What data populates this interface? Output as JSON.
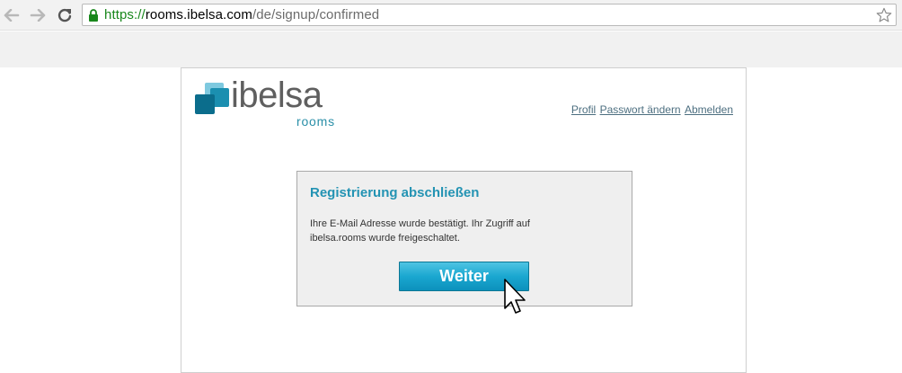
{
  "browser": {
    "url_scheme": "https://",
    "url_host": "rooms.ibelsa.com",
    "url_path": "/de/signup/confirmed",
    "icons": [
      "back-arrow-icon",
      "forward-arrow-icon",
      "reload-icon",
      "lock-icon",
      "star-icon"
    ]
  },
  "logo": {
    "word": "ibelsa",
    "sub": "rooms",
    "colors": [
      "#1b8fb0",
      "#7ec9df",
      "#0b6d8c"
    ]
  },
  "nav": {
    "links": [
      "Profil",
      "Passwort ändern",
      "Abmelden"
    ]
  },
  "card": {
    "title": "Registrierung abschließen",
    "line1": "Ihre E-Mail Adresse wurde bestätigt. Ihr Zugriff auf",
    "line2": "ibelsa.rooms wurde freigeschaltet.",
    "button": "Weiter"
  },
  "colors": {
    "accent": "#2393b3",
    "button": "#1aa7d0",
    "link": "#4d6f80",
    "secure_green": "#19871c"
  }
}
